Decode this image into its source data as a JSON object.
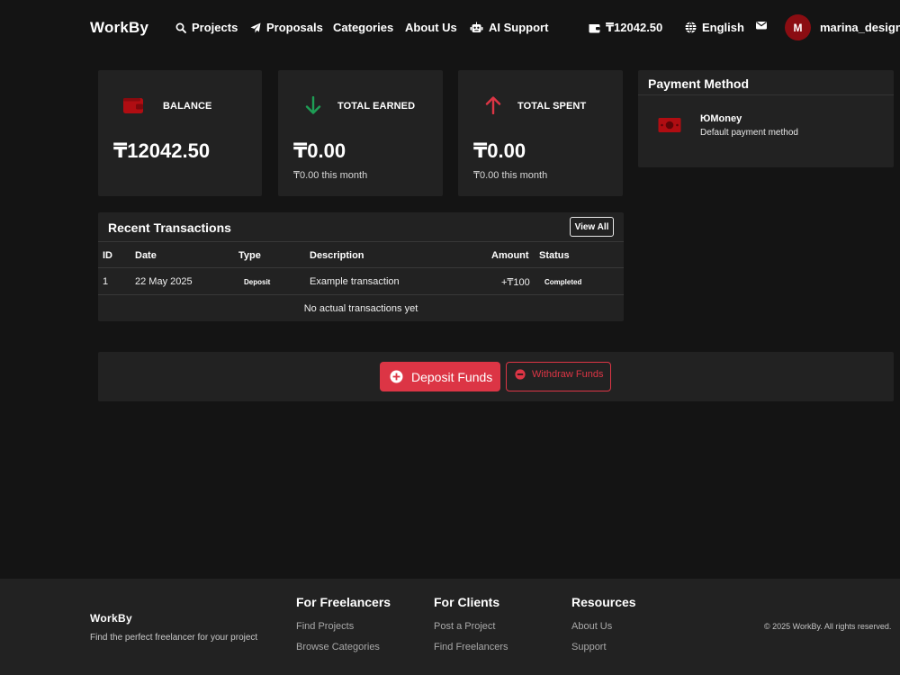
{
  "navbar": {
    "brand": "WorkBy",
    "items": [
      {
        "label": "Projects",
        "icon": "search-icon"
      },
      {
        "label": "Proposals",
        "icon": "send-icon"
      },
      {
        "label": "Categories"
      },
      {
        "label": "About Us"
      },
      {
        "label": "AI Support",
        "icon": "robot-icon"
      }
    ],
    "wallet_balance": "₸12042.50",
    "language": "English",
    "avatar_initial": "M",
    "username": "marina_design"
  },
  "stats": [
    {
      "label": "BALANCE",
      "value": "₸12042.50",
      "sub": "",
      "icon": "wallet-icon",
      "color": "#b00d12"
    },
    {
      "label": "TOTAL EARNED",
      "value": "₸0.00",
      "sub": "₸0.00 this month",
      "icon": "arrow-down-icon",
      "color": "#1e9e55"
    },
    {
      "label": "TOTAL SPENT",
      "value": "₸0.00",
      "sub": "₸0.00 this month",
      "icon": "arrow-up-icon",
      "color": "#dc3545"
    }
  ],
  "payment_method": {
    "title": "Payment Method",
    "name": "ЮMoney",
    "description": "Default payment method",
    "icon": "money-bill-icon"
  },
  "transactions": {
    "title": "Recent Transactions",
    "view_all_label": "View All",
    "columns": [
      "ID",
      "Date",
      "Type",
      "Description",
      "Amount",
      "Status"
    ],
    "rows": [
      {
        "id": "1",
        "date": "22 May 2025",
        "type": "Deposit",
        "description": "Example transaction",
        "amount": "+₸100",
        "status": "Completed"
      }
    ],
    "empty_message": "No actual transactions yet"
  },
  "actions": {
    "deposit_label": "Deposit Funds",
    "withdraw_label": "Withdraw Funds"
  },
  "footer": {
    "brand": "WorkBy",
    "tagline": "Find the perfect freelancer for your project",
    "columns": [
      {
        "title": "For Freelancers",
        "links": [
          "Find Projects",
          "Browse Categories"
        ]
      },
      {
        "title": "For Clients",
        "links": [
          "Post a Project",
          "Find Freelancers"
        ]
      },
      {
        "title": "Resources",
        "links": [
          "About Us",
          "Support"
        ]
      }
    ],
    "copyright": "© 2025 WorkBy. All rights reserved."
  },
  "colors": {
    "accent": "#dc3545",
    "avatar_bg": "#8b0d12",
    "background": "#141414",
    "card": "#222222"
  }
}
